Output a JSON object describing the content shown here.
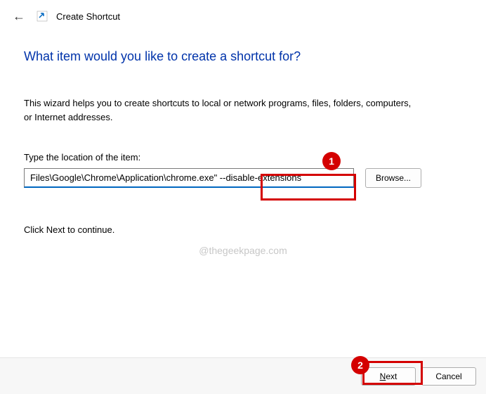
{
  "header": {
    "title": "Create Shortcut"
  },
  "main": {
    "heading": "What item would you like to create a shortcut for?",
    "description": "This wizard helps you to create shortcuts to local or network programs, files, folders, computers, or Internet addresses.",
    "field_label": "Type the location of the item:",
    "path_value": "Files\\Google\\Chrome\\Application\\chrome.exe\" --disable-extensions",
    "browse_label": "Browse...",
    "continue_hint": "Click Next to continue."
  },
  "footer": {
    "next_prefix": "N",
    "next_rest": "ext",
    "cancel_label": "Cancel"
  },
  "watermark": "@thegeekpage.com",
  "annotations": {
    "badge1": "1",
    "badge2": "2"
  }
}
